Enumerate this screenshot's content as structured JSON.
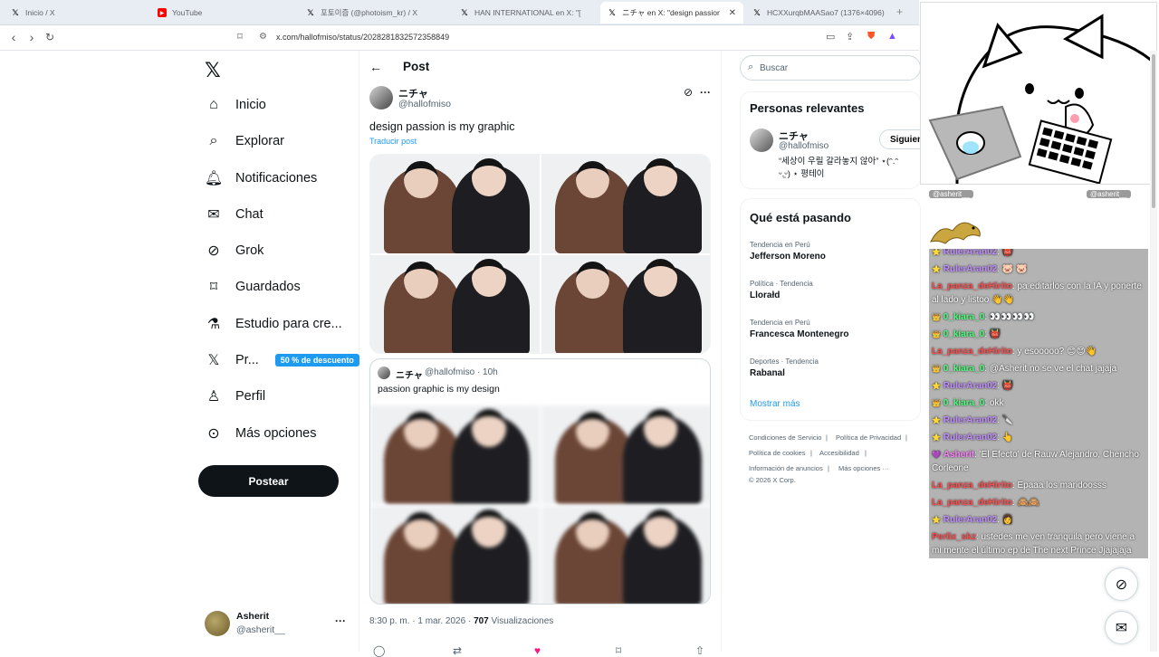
{
  "tabs": [
    {
      "label": "Inicio / X",
      "favicon": "x-logo"
    },
    {
      "label": "YouTube",
      "favicon": "youtube-logo"
    },
    {
      "label": "포토이즘 (@photoism_kr) / X",
      "favicon": "x-logo"
    },
    {
      "label": "HAN INTERNATIONAL en X: \"[",
      "favicon": "x-logo"
    },
    {
      "label": "ニチャ en X: \"design passion is my",
      "favicon": "x-logo",
      "active": true
    },
    {
      "label": "HCXXurqbMAASao7 (1376×4096)",
      "favicon": "x-logo"
    }
  ],
  "address": "x.com/hallofmiso/status/2028281832572358849",
  "nav": {
    "items": [
      {
        "label": "Inicio",
        "icon": "home-icon"
      },
      {
        "label": "Explorar",
        "icon": "search-icon"
      },
      {
        "label": "Notificaciones",
        "icon": "bell-icon"
      },
      {
        "label": "Chat",
        "icon": "mail-icon"
      },
      {
        "label": "Grok",
        "icon": "grok-icon"
      },
      {
        "label": "Guardados",
        "icon": "bookmark-icon"
      },
      {
        "label": "Estudio para cre...",
        "icon": "flask-icon"
      },
      {
        "label": "Pr...",
        "icon": "x-icon",
        "badge": "50 % de descuento"
      },
      {
        "label": "Perfil",
        "icon": "person-icon"
      },
      {
        "label": "Más opciones",
        "icon": "more-circle-icon"
      }
    ],
    "post_button": "Postear",
    "account": {
      "name": "Asherit",
      "handle": "@asherit__"
    }
  },
  "main": {
    "header": "Post",
    "author": {
      "name": "ニチャ",
      "handle": "@hallofmiso"
    },
    "text": "design passion is my graphic",
    "translate": "Traducir post",
    "quote": {
      "name": "ニチャ",
      "handle": "@hallofmiso · 10h",
      "text": "passion graphic is my design"
    },
    "meta_time": "8:30 p. m. · 1 mar. 2026 · ",
    "meta_views_count": "707",
    "meta_views_label": " Visualizaciones"
  },
  "right": {
    "search_placeholder": "Buscar",
    "relevant": {
      "title": "Personas relevantes",
      "name": "ニチャ",
      "handle": "@hallofmiso",
      "follow": "Siguien",
      "bio_line1": "“세상이 우릴 갈라놓지 않아” ⋆(ᵔ.ᵔ",
      "bio_line2": "ᵕ.̫ᵕ) ⋆ 평테이"
    },
    "trends_title": "Qué está pasando",
    "trends": [
      {
        "cat": "Tendencia en Perú",
        "name": "Jefferson Moreno"
      },
      {
        "cat": "Política · Tendencia",
        "name": "Llorałd"
      },
      {
        "cat": "Tendencia en Perú",
        "name": "Francesca Montenegro"
      },
      {
        "cat": "Deportes · Tendencia",
        "name": "Rabanal"
      }
    ],
    "show_more": "Mostrar más",
    "footer": [
      "Condiciones de Servicio",
      "|",
      "Política de Privacidad",
      "|",
      "Política de cookies",
      "|",
      "Accesibilidad",
      "|",
      "Información de anuncios",
      "|",
      "Más opciones ···",
      "© 2026 X Corp."
    ]
  },
  "overlay": {
    "hdr_left": "@asherit__",
    "hdr_right": "@asherit__",
    "messages": [
      {
        "user": "RulerAran02",
        "color": "purple",
        "text": ": 👹"
      },
      {
        "user": "RulerAran02",
        "color": "purple",
        "text": ": 🐷 🐷"
      },
      {
        "user": "La_panza_deHirito",
        "color": "red",
        "text": ": pa editarlos con la IA y ponerte al lado y listoo 👋👋"
      },
      {
        "user": "0_kiara_0",
        "color": "green",
        "text": ": 👀👀👀👀"
      },
      {
        "user": "0_kiara_0",
        "color": "green",
        "text": ": 👹"
      },
      {
        "user": "La_panza_deHirito",
        "color": "red",
        "text": ": y esooooo? 😊😊👋"
      },
      {
        "user": "0_kiara_0",
        "color": "green",
        "text": ": @Asherit no se ve el chat jajaja"
      },
      {
        "user": "RulerAran02",
        "color": "purple",
        "text": ": 👹"
      },
      {
        "user": "0_kiara_0",
        "color": "green",
        "text": ": okk"
      },
      {
        "user": "RulerAran02",
        "color": "purple",
        "text": ": 🔪"
      },
      {
        "user": "RulerAran02",
        "color": "purple",
        "text": ": 👆"
      },
      {
        "user": "Asherit",
        "color": "mag",
        "text": ": 'El Efecto' de Rauw Alejandro, Chencho Corleone"
      },
      {
        "user": "La_panza_deHirito",
        "color": "red",
        "text": ": Epaaa los maridoosss"
      },
      {
        "user": "La_panza_deHirito",
        "color": "red",
        "text": ": 🙈🙈"
      },
      {
        "user": "RulerAran02",
        "color": "purple",
        "text": ": 👩"
      },
      {
        "user": "Perlix_skz",
        "color": "red",
        "text": ": ustedes me ven tranquila pero viene a mi mente el último ep de The next Prince Jjajajaja"
      }
    ]
  }
}
